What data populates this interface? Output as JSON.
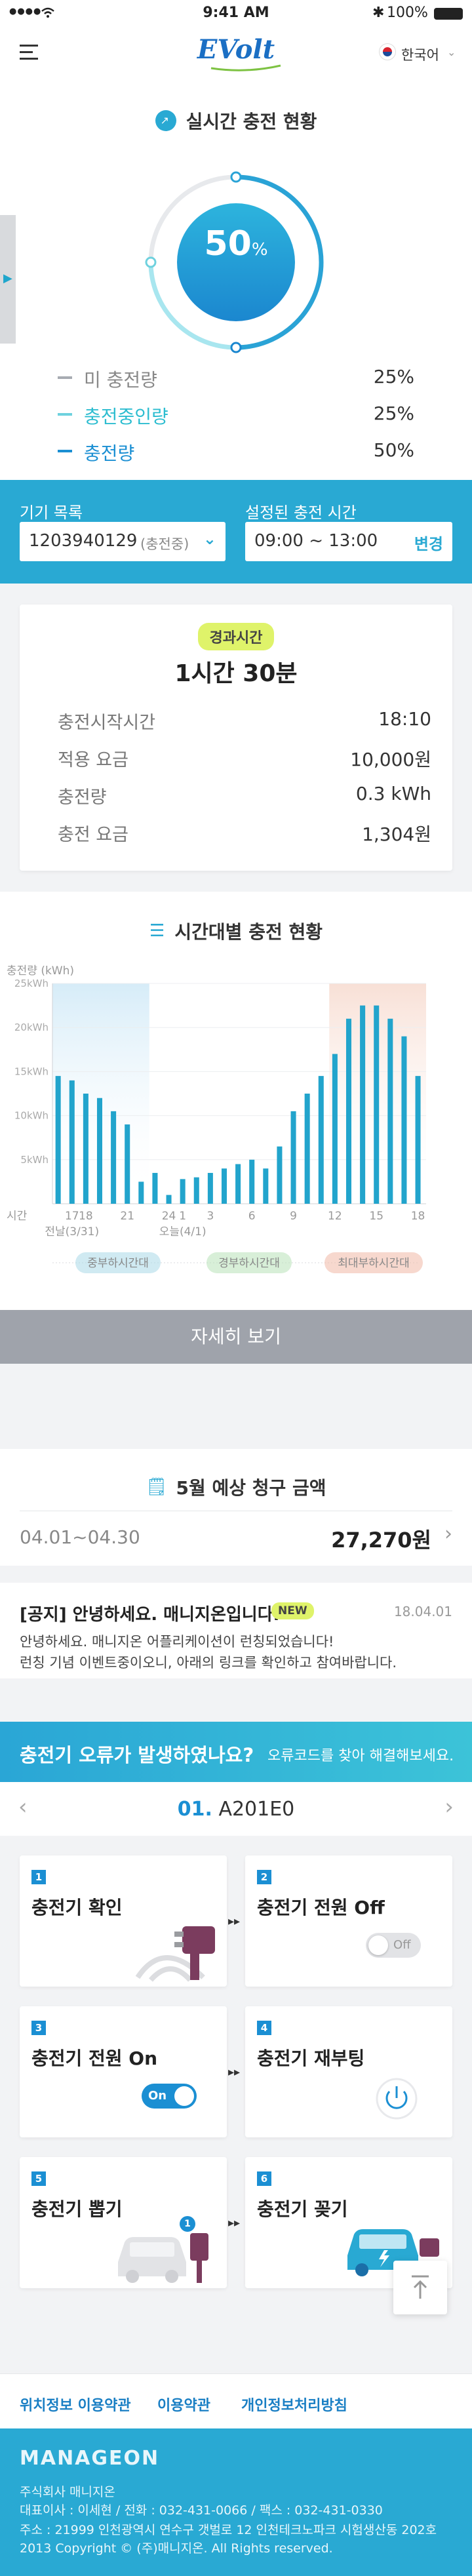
{
  "status_bar": {
    "time": "9:41 AM",
    "battery": "100%"
  },
  "header": {
    "logo": "EVolt",
    "language": "한국어"
  },
  "realtime": {
    "title": "실시간 충전 현황",
    "percent": "50",
    "percent_unit": "%",
    "progress": 0.5,
    "legend": [
      {
        "label": "미 충전량",
        "value": "25%"
      },
      {
        "label": "충전중인량",
        "value": "25%"
      },
      {
        "label": "충전량",
        "value": "50%"
      }
    ]
  },
  "device_bar": {
    "device_label": "기기 목록",
    "device_value": "1203940129",
    "device_status": "(충전중)",
    "time_label": "설정된 충전 시간",
    "time_value": "09:00 ~ 13:00",
    "change_button": "변경"
  },
  "elapsed": {
    "badge": "경과시간",
    "value": "1시간 30분",
    "rows": [
      {
        "label": "충전시작시간",
        "value": "18:10"
      },
      {
        "label": "적용 요금",
        "value": "10,000원"
      },
      {
        "label": "충전량",
        "value": "0.3 kWh"
      },
      {
        "label": "충전 요금",
        "value": "1,304원"
      }
    ]
  },
  "hourly": {
    "title": "시간대별 충전 현황",
    "more_button": "자세히 보기",
    "legend": [
      {
        "label": "중부하시간대",
        "color": "#a9d8e8"
      },
      {
        "label": "경부하시간대",
        "color": "#b8e1b8"
      },
      {
        "label": "최대부하시간대",
        "color": "#f0b8a6"
      }
    ]
  },
  "chart_data": {
    "type": "bar",
    "ylabel": "충전량 (kWh)",
    "xlabel": "시간",
    "ylim": [
      0,
      25
    ],
    "yticks": [
      {
        "v": 5,
        "label": "5kWh"
      },
      {
        "v": 10,
        "label": "10kWh"
      },
      {
        "v": 15,
        "label": "15kWh"
      },
      {
        "v": 20,
        "label": "20kWh"
      },
      {
        "v": 25,
        "label": "25kWh"
      }
    ],
    "values": [
      14.5,
      14,
      12.5,
      12,
      10.5,
      9,
      2.5,
      3.5,
      1,
      2.8,
      3,
      3.5,
      4,
      4.5,
      5,
      4,
      6.5,
      10.5,
      12.5,
      14.5,
      17,
      21,
      22.5,
      22.5,
      21,
      19,
      14.5
    ],
    "xtick_labels": [
      {
        "i": 1,
        "label": "17"
      },
      {
        "i": 2,
        "label": "18"
      },
      {
        "i": 5,
        "label": "21"
      },
      {
        "i": 8,
        "label": "24"
      },
      {
        "i": 9,
        "label": "1"
      },
      {
        "i": 11,
        "label": "3"
      },
      {
        "i": 14,
        "label": "6"
      },
      {
        "i": 17,
        "label": "9"
      },
      {
        "i": 20,
        "label": "12"
      },
      {
        "i": 23,
        "label": "15"
      },
      {
        "i": 26,
        "label": "18"
      }
    ],
    "day_labels": [
      {
        "i": 1,
        "label": "전날(3/31)"
      },
      {
        "i": 9,
        "label": "오늘(4/1)"
      }
    ],
    "bands": [
      {
        "from": 0,
        "to": 6,
        "color": "#d6ecf8"
      },
      {
        "from": 20,
        "to": 26,
        "color": "#f8e0d6"
      }
    ]
  },
  "bill": {
    "title": "5월 예상 청구 금액",
    "period": "04.01~04.30",
    "amount": "27,270원"
  },
  "notice": {
    "title": "[공지] 안녕하세요. 매니지온입니다.",
    "badge": "NEW",
    "date": "18.04.01",
    "body_line1": "안녕하세요. 매니지온 어플리케이션이 런칭되었습니다!",
    "body_line2": "런칭 기념 이벤트중이오니, 아래의 링크를 확인하고 참여바랍니다."
  },
  "error_banner": {
    "title": "충전기 오류가 발생하였나요?",
    "subtitle": "오류코드를 찾아 해결해보세요."
  },
  "error_code": {
    "number": "01.",
    "code": "A201E0"
  },
  "steps": [
    {
      "num": "1",
      "title": "충전기 확인"
    },
    {
      "num": "2",
      "title": "충전기 전원 Off",
      "toggle": "Off"
    },
    {
      "num": "3",
      "title": "충전기 전원 On",
      "toggle": "On"
    },
    {
      "num": "4",
      "title": "충전기 재부팅"
    },
    {
      "num": "5",
      "title": "충전기 뽑기",
      "bubble": "1"
    },
    {
      "num": "6",
      "title": "충전기 꽂기"
    }
  ],
  "footer": {
    "links": [
      "위치정보 이용약관",
      "이용약관",
      "개인정보처리방침"
    ],
    "brand": "MANAGEON",
    "company": "주식회사 매니지온",
    "contact": "대표이사 : 이세현 / 전화 : 032-431-0066 / 팩스 : 032-431-0330",
    "address": "주소 : 21999 인천광역시 연수구 갯벌로 12 인천테크노파크 시험생산동 202호",
    "copyright": "2013 Copyright © (주)매니지온. All Rights reserved."
  },
  "colors": {
    "primary": "#29a9d3",
    "gauge_start": "#a8e6ef",
    "gauge_end": "#1b8fd3",
    "teal": "#2dbdd0"
  }
}
